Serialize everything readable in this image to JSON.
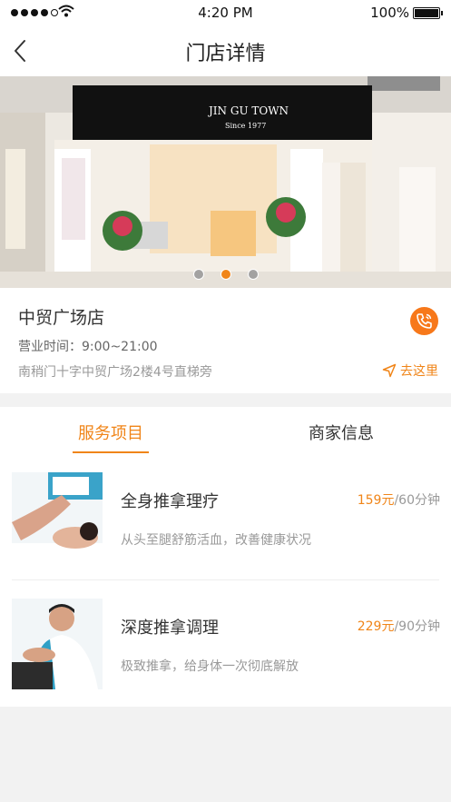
{
  "status_bar": {
    "time": "4:20 PM",
    "battery": "100%",
    "icons": [
      "signal-dots-icon",
      "wifi-icon",
      "battery-icon"
    ]
  },
  "header": {
    "title": "门店详情",
    "back_icon": "chevron-left-icon"
  },
  "banner": {
    "sign_text": "JIN GU TOWN",
    "sign_sub": "Since 1977",
    "slide_count": 3,
    "active_slide": 2,
    "indicator_color": "#f08519"
  },
  "store": {
    "name": "中贸广场店",
    "hours": "营业时间：9:00~21:00",
    "address": "南稍门十字中贸广场2楼4号直梯旁",
    "directions_label": "去这里",
    "phone_icon": "phone-icon",
    "directions_icon": "navigation-arrow-icon"
  },
  "tabs": [
    {
      "label": "服务项目",
      "active": true
    },
    {
      "label": "商家信息",
      "active": false
    }
  ],
  "services": [
    {
      "name": "全身推拿理疗",
      "price": "159元",
      "duration": "/60分钟",
      "desc": "从头至腿舒筋活血，改善健康状况"
    },
    {
      "name": "深度推拿调理",
      "price": "229元",
      "duration": "/90分钟",
      "desc": "极致推拿，给身体一次彻底解放"
    }
  ],
  "colors": {
    "accent": "#f08519",
    "phone_button": "#f7781a",
    "background": "#f2f2f2"
  }
}
